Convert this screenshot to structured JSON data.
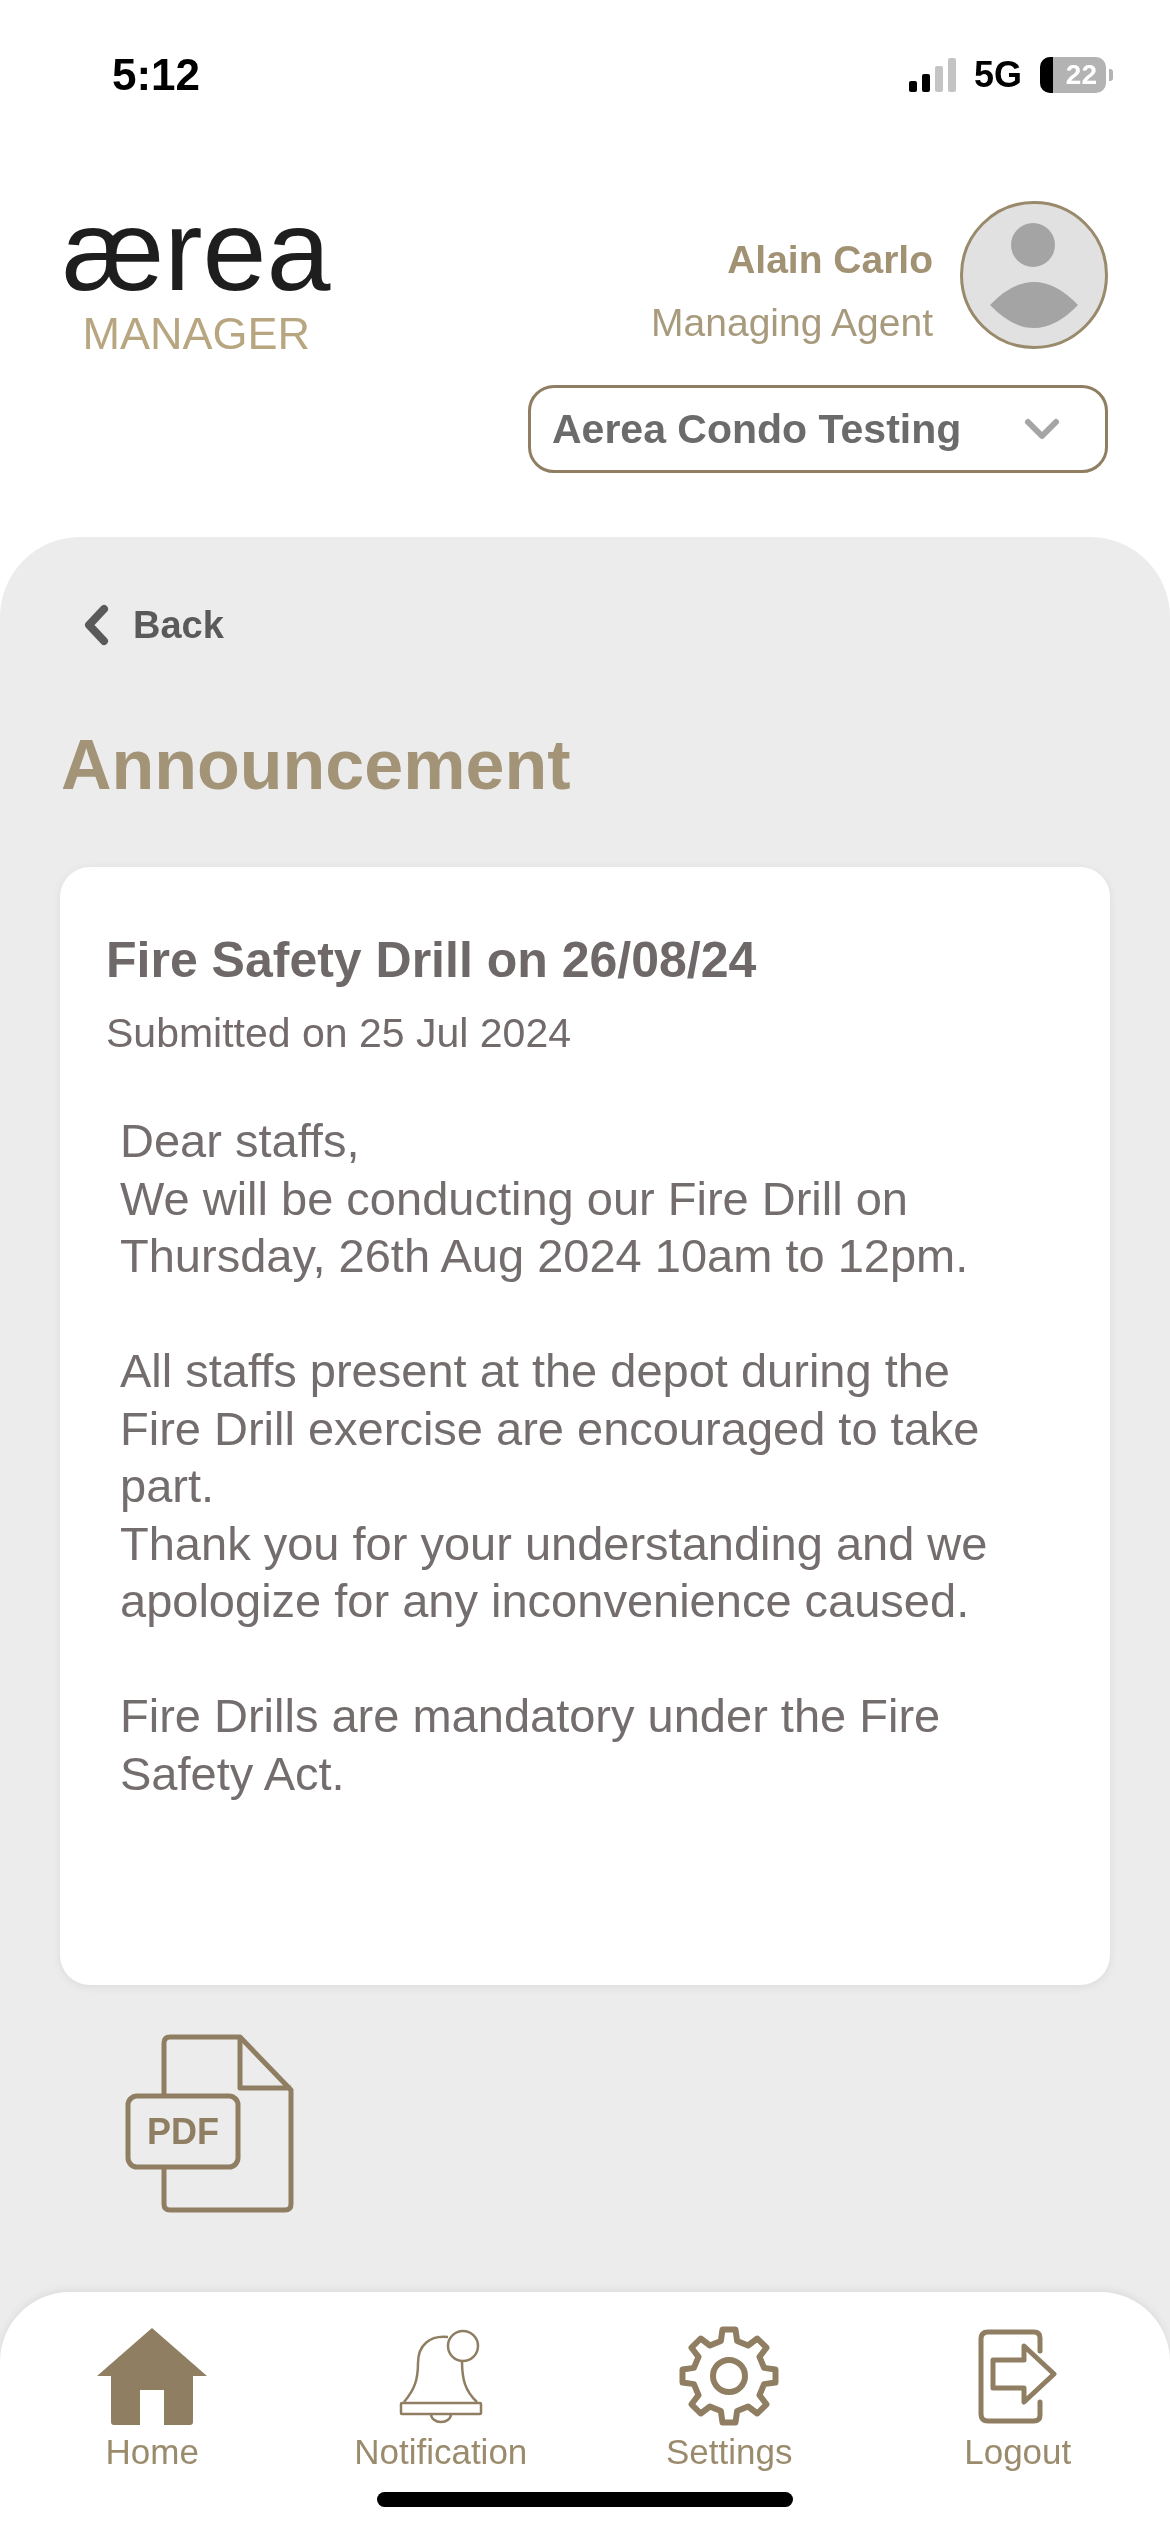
{
  "status_bar": {
    "time": "5:12",
    "network": "5G",
    "battery": "22"
  },
  "header": {
    "logo": {
      "wordmark": "ærea",
      "subtitle": "MANAGER"
    },
    "user": {
      "name": "Alain Carlo",
      "role": "Managing Agent"
    },
    "property_selector": {
      "value": "Aerea Condo Testing"
    }
  },
  "back_button": {
    "label": "Back"
  },
  "page_title": "Announcement",
  "announcement": {
    "title": "Fire Safety Drill on 26/08/24",
    "submitted": "Submitted on 25 Jul 2024",
    "body": "Dear staffs,\nWe will be conducting our Fire Drill on Thursday, 26th Aug 2024 10am to 12pm.\n\nAll staffs present at the depot during the Fire Drill exercise are encouraged to take part.\nThank you for your understanding and we apologize for any inconvenience caused.\n\nFire Drills are mandatory under the Fire Safety Act."
  },
  "attachments": [
    {
      "type_label": "PDF"
    }
  ],
  "bottom_nav": [
    {
      "label": "Home"
    },
    {
      "label": "Notification"
    },
    {
      "label": "Settings"
    },
    {
      "label": "Logout"
    }
  ]
}
